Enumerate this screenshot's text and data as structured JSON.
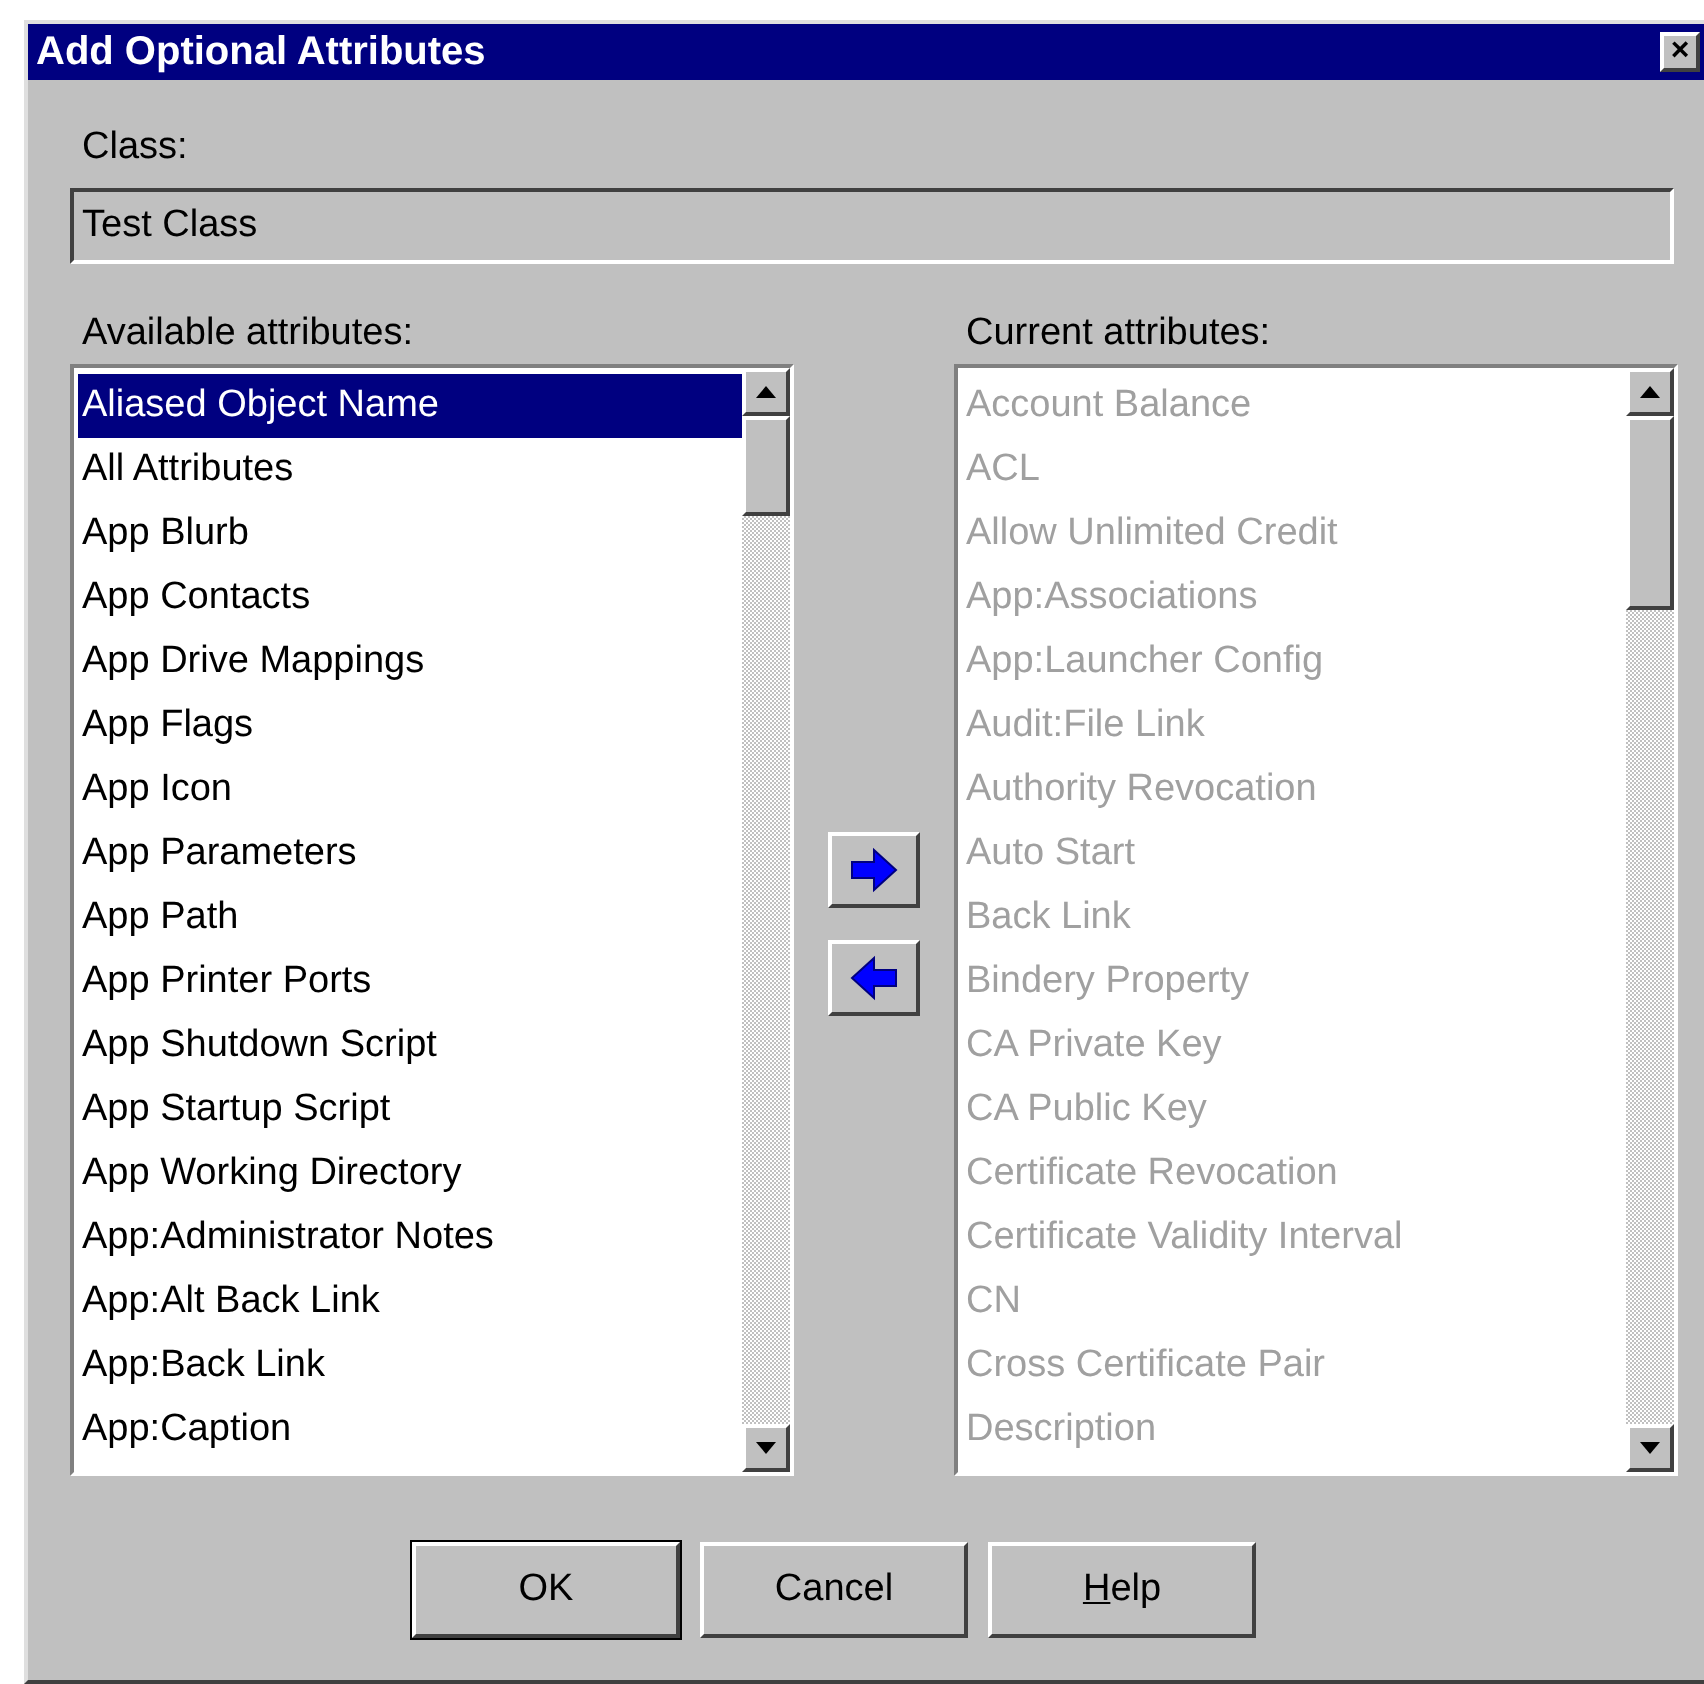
{
  "window": {
    "title": "Add Optional Attributes",
    "close": "×"
  },
  "class_field": {
    "label": "Class:",
    "value": "Test Class"
  },
  "available": {
    "label": "Available attributes:",
    "disabled": false,
    "items": [
      {
        "label": "Aliased Object Name",
        "selected": true
      },
      {
        "label": "All Attributes",
        "selected": false
      },
      {
        "label": "App Blurb",
        "selected": false
      },
      {
        "label": "App Contacts",
        "selected": false
      },
      {
        "label": "App Drive Mappings",
        "selected": false
      },
      {
        "label": "App Flags",
        "selected": false
      },
      {
        "label": "App Icon",
        "selected": false
      },
      {
        "label": "App Parameters",
        "selected": false
      },
      {
        "label": "App Path",
        "selected": false
      },
      {
        "label": "App Printer Ports",
        "selected": false
      },
      {
        "label": "App Shutdown Script",
        "selected": false
      },
      {
        "label": "App Startup Script",
        "selected": false
      },
      {
        "label": "App Working Directory",
        "selected": false
      },
      {
        "label": "App:Administrator Notes",
        "selected": false
      },
      {
        "label": "App:Alt Back Link",
        "selected": false
      },
      {
        "label": "App:Back Link",
        "selected": false
      },
      {
        "label": "App:Caption",
        "selected": false
      }
    ]
  },
  "current": {
    "label": "Current attributes:",
    "disabled": true,
    "items": [
      {
        "label": "Account Balance",
        "selected": false
      },
      {
        "label": "ACL",
        "selected": false
      },
      {
        "label": "Allow Unlimited Credit",
        "selected": false
      },
      {
        "label": "App:Associations",
        "selected": false
      },
      {
        "label": "App:Launcher Config",
        "selected": false
      },
      {
        "label": "Audit:File Link",
        "selected": false
      },
      {
        "label": "Authority Revocation",
        "selected": false
      },
      {
        "label": "Auto Start",
        "selected": false
      },
      {
        "label": "Back Link",
        "selected": false
      },
      {
        "label": "Bindery Property",
        "selected": false
      },
      {
        "label": "CA Private Key",
        "selected": false
      },
      {
        "label": "CA Public Key",
        "selected": false
      },
      {
        "label": "Certificate Revocation",
        "selected": false
      },
      {
        "label": "Certificate Validity Interval",
        "selected": false
      },
      {
        "label": "CN",
        "selected": false
      },
      {
        "label": "Cross Certificate Pair",
        "selected": false
      },
      {
        "label": "Description",
        "selected": false
      }
    ]
  },
  "buttons": [
    {
      "label": "OK",
      "default": true,
      "underline_first": false
    },
    {
      "label": "Cancel",
      "default": false,
      "underline_first": false
    },
    {
      "label": "Help",
      "default": false,
      "underline_first": true
    }
  ]
}
